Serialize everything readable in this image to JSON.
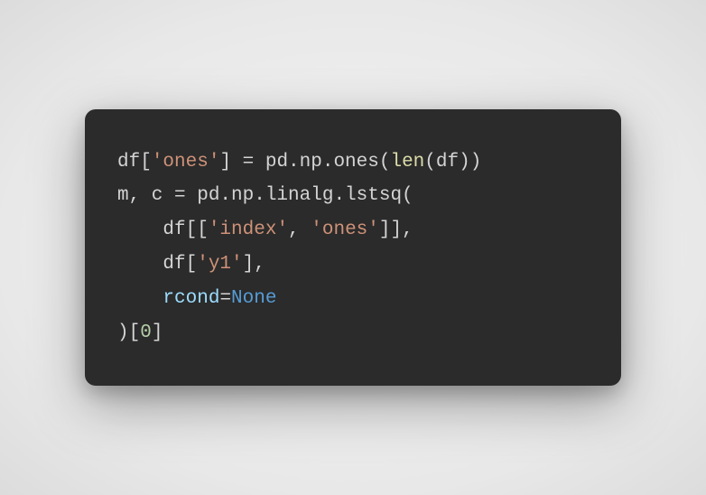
{
  "code": {
    "line1": {
      "t1": "df[",
      "t2": "'ones'",
      "t3": "] = pd.np.ones(",
      "t4": "len",
      "t5": "(df))"
    },
    "line2": {
      "t1": "m, c = pd.np.linalg.lstsq("
    },
    "line3": {
      "t1": "    df[[",
      "t2": "'index'",
      "t3": ", ",
      "t4": "'ones'",
      "t5": "]],"
    },
    "line4": {
      "t1": "    df[",
      "t2": "'y1'",
      "t3": "],"
    },
    "line5": {
      "t1": "    ",
      "t2": "rcond",
      "t3": "=",
      "t4": "None"
    },
    "line6": {
      "t1": ")[",
      "t2": "0",
      "t3": "]"
    }
  }
}
